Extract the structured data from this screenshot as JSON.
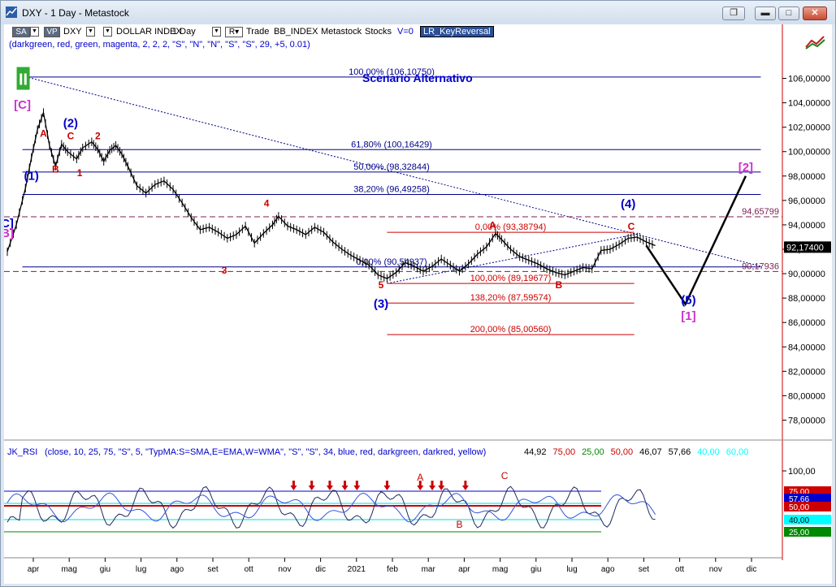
{
  "window": {
    "title": "DXY - 1 Day - Metastock",
    "buttons": [
      "restore",
      "minimize",
      "maximize",
      "close"
    ]
  },
  "toolbar": {
    "sa": "SA",
    "vp": "VP",
    "symbol": "DXY",
    "name": "DOLLAR INDEX",
    "period": "1 Day",
    "r_btn": "R",
    "trade": "Trade",
    "index": "BB_INDEX",
    "source": "Metastock",
    "stocks": "Stocks",
    "v": "V=0",
    "indicator": "LR_KeyReversal",
    "params": "(darkgreen, red, green, magenta, 2, 2, 2, \"S\", \"N\", \"N\", \"S\", \"S\", 29, +5, 0.01)"
  },
  "chart_data": {
    "type": "line",
    "title": "Scenario Alternativo",
    "price_axis": {
      "ylim": [
        76.5,
        107.5
      ],
      "ticks": [
        "106,00000",
        "104,00000",
        "102,00000",
        "100,00000",
        "98,00000",
        "96,00000",
        "94,00000",
        "92,00000",
        "90,00000",
        "88,00000",
        "86,00000",
        "84,00000",
        "82,00000",
        "80,00000",
        "78,00000"
      ],
      "tick_values": [
        106,
        104,
        102,
        100,
        98,
        96,
        94,
        92,
        90,
        88,
        86,
        84,
        82,
        80,
        78
      ]
    },
    "x_axis": {
      "labels": [
        "apr",
        "mag",
        "giu",
        "lug",
        "ago",
        "set",
        "ott",
        "nov",
        "dic",
        "2021",
        "feb",
        "mar",
        "apr",
        "mag",
        "giu",
        "lug",
        "ago",
        "set",
        "ott",
        "nov",
        "dic"
      ]
    },
    "last_price": "92,17400",
    "price_series": [
      [
        0,
        91.8
      ],
      [
        3,
        94.0
      ],
      [
        6,
        97.0
      ],
      [
        8,
        99.5
      ],
      [
        10,
        101.8
      ],
      [
        12,
        103.2
      ],
      [
        14,
        100.5
      ],
      [
        16,
        98.8
      ],
      [
        18,
        100.6
      ],
      [
        20,
        100.0
      ],
      [
        23,
        99.4
      ],
      [
        25,
        100.3
      ],
      [
        28,
        100.8
      ],
      [
        30,
        100.2
      ],
      [
        32,
        99.2
      ],
      [
        34,
        100.1
      ],
      [
        36,
        100.5
      ],
      [
        38,
        99.8
      ],
      [
        40,
        98.8
      ],
      [
        43,
        97.2
      ],
      [
        46,
        96.6
      ],
      [
        49,
        97.3
      ],
      [
        52,
        97.6
      ],
      [
        55,
        96.9
      ],
      [
        58,
        95.8
      ],
      [
        61,
        94.6
      ],
      [
        64,
        93.6
      ],
      [
        67,
        93.8
      ],
      [
        70,
        93.4
      ],
      [
        73,
        92.9
      ],
      [
        76,
        93.2
      ],
      [
        79,
        93.9
      ],
      [
        82,
        92.5
      ],
      [
        85,
        93.3
      ],
      [
        88,
        94.0
      ],
      [
        90,
        94.7
      ],
      [
        93,
        93.9
      ],
      [
        96,
        93.6
      ],
      [
        99,
        93.2
      ],
      [
        102,
        93.8
      ],
      [
        105,
        93.4
      ],
      [
        108,
        92.6
      ],
      [
        111,
        92.0
      ],
      [
        114,
        91.5
      ],
      [
        117,
        91.1
      ],
      [
        120,
        90.7
      ],
      [
        123,
        89.9
      ],
      [
        126,
        89.6
      ],
      [
        129,
        90.1
      ],
      [
        132,
        90.9
      ],
      [
        135,
        90.6
      ],
      [
        138,
        90.2
      ],
      [
        141,
        90.6
      ],
      [
        144,
        91.2
      ],
      [
        147,
        90.7
      ],
      [
        150,
        90.2
      ],
      [
        153,
        90.8
      ],
      [
        156,
        91.6
      ],
      [
        159,
        92.2
      ],
      [
        162,
        93.3
      ],
      [
        164,
        92.8
      ],
      [
        167,
        92.0
      ],
      [
        170,
        91.4
      ],
      [
        173,
        91.1
      ],
      [
        176,
        90.8
      ],
      [
        179,
        90.4
      ],
      [
        182,
        90.1
      ],
      [
        185,
        89.9
      ],
      [
        188,
        90.2
      ],
      [
        191,
        90.5
      ],
      [
        194,
        90.4
      ],
      [
        197,
        91.9
      ],
      [
        200,
        92.0
      ],
      [
        203,
        92.4
      ],
      [
        206,
        92.9
      ],
      [
        209,
        93.0
      ],
      [
        212,
        92.6
      ],
      [
        215,
        92.3
      ]
    ],
    "wave_labels": [
      {
        "text": "II",
        "color": "#ffffff",
        "bg": "#33aa33",
        "x": 5,
        "y": 106.0
      },
      {
        "text": "[C]",
        "color": "#cc33cc",
        "x": 5,
        "y": 103.5
      },
      {
        "text": "C]",
        "color": "#0000cc",
        "x": 0,
        "y": 93.8
      },
      {
        "text": "B]",
        "color": "#cc33cc",
        "x": 0,
        "y": 93.0
      },
      {
        "text": "(1)",
        "color": "#0000cc",
        "x": 8,
        "y": 97.7
      },
      {
        "text": "(2)",
        "color": "#0000cc",
        "x": 21,
        "y": 102.0
      },
      {
        "text": "A",
        "color": "#cc0000",
        "x": 12,
        "y": 101.2
      },
      {
        "text": "B",
        "color": "#cc0000",
        "x": 16,
        "y": 98.3
      },
      {
        "text": "C",
        "color": "#cc0000",
        "x": 21,
        "y": 101.0
      },
      {
        "text": "1",
        "color": "#cc0000",
        "x": 24,
        "y": 98.0
      },
      {
        "text": "2",
        "color": "#cc0000",
        "x": 30,
        "y": 101.0
      },
      {
        "text": "3",
        "color": "#cc0000",
        "x": 72,
        "y": 90.0
      },
      {
        "text": "4",
        "color": "#cc0000",
        "x": 86,
        "y": 95.5
      },
      {
        "text": "5",
        "color": "#cc0000",
        "x": 124,
        "y": 88.8
      },
      {
        "text": "(3)",
        "color": "#0000cc",
        "x": 124,
        "y": 87.2
      },
      {
        "text": "A",
        "color": "#cc0000",
        "x": 161,
        "y": 93.7
      },
      {
        "text": "B",
        "color": "#cc0000",
        "x": 183,
        "y": 88.8
      },
      {
        "text": "C",
        "color": "#cc0000",
        "x": 207,
        "y": 93.6
      },
      {
        "text": "(4)",
        "color": "#0000cc",
        "x": 206,
        "y": 95.4
      },
      {
        "text": "(5)",
        "color": "#0000cc",
        "x": 226,
        "y": 87.5
      },
      {
        "text": "[1]",
        "color": "#cc33cc",
        "x": 226,
        "y": 86.2
      },
      {
        "text": "[2]",
        "color": "#cc33cc",
        "x": 245,
        "y": 98.4
      }
    ],
    "fib_levels": [
      {
        "label": "100,00% (106,10750)",
        "value": 106.1075,
        "x0": 5,
        "x1": 250,
        "color": "#00008b"
      },
      {
        "label": "61,80% (100,16429)",
        "value": 100.16429,
        "x0": 5,
        "x1": 250,
        "color": "#00008b"
      },
      {
        "label": "50,00% (98,32844)",
        "value": 98.32844,
        "x0": 5,
        "x1": 250,
        "color": "#00008b"
      },
      {
        "label": "38,20% (96,49258)",
        "value": 96.49258,
        "x0": 5,
        "x1": 250,
        "color": "#00008b"
      },
      {
        "label": "0,00% (93,38794)",
        "value": 93.38794,
        "x0": 126,
        "x1": 208,
        "color": "#cc0000"
      },
      {
        "label": "0,00% (90,54937)",
        "value": 90.54937,
        "x0": 5,
        "x1": 250,
        "color": "#00008b"
      },
      {
        "label": "100,00% (89,19677)",
        "value": 89.19677,
        "x0": 126,
        "x1": 208,
        "color": "#cc0000"
      },
      {
        "label": "138,20% (87,59574)",
        "value": 87.59574,
        "x0": 126,
        "x1": 208,
        "color": "#cc0000"
      },
      {
        "label": "200,00% (85,00560)",
        "value": 85.0056,
        "x0": 126,
        "x1": 208,
        "color": "#cc0000"
      }
    ],
    "dashed_levels": [
      {
        "label": "94,65799",
        "value": 94.65799
      },
      {
        "label": "90,17936",
        "value": 90.17936
      }
    ],
    "projection": [
      [
        212,
        92.3
      ],
      [
        225,
        87.5
      ],
      [
        245,
        98.0
      ]
    ],
    "trendline_upper": [
      [
        5,
        106.2
      ],
      [
        250,
        90.6
      ]
    ],
    "trendline_channel": [
      [
        126,
        89.2
      ],
      [
        210,
        93.3
      ]
    ]
  },
  "rsi_panel": {
    "title": "JK_RSI",
    "params": "(close, 10, 25, 75, \"S\", 5, \"TypMA:S=SMA,E=EMA,W=WMA\", \"S\", \"S\", 34, blue, red, darkgreen, darkred, yellow)",
    "values": [
      "44,92",
      "75,00",
      "25,00",
      "50,00",
      "46,07",
      "57,66",
      "40,00",
      "60,00"
    ],
    "value_colors": [
      "#000000",
      "#cc0000",
      "#008800",
      "#cc0000",
      "#000000",
      "#000000",
      "#00ffff",
      "#00ffff"
    ],
    "ylim": [
      10,
      110
    ],
    "ticks": [
      {
        "label": "100,00",
        "value": 100
      }
    ],
    "badges": [
      {
        "label": "75,00",
        "value": 75,
        "bg": "#cc0000",
        "fg": "#ffffff"
      },
      {
        "label": "57,66",
        "value": 66,
        "bg": "#0000cc",
        "fg": "#ffffff"
      },
      {
        "label": "50,00",
        "value": 56,
        "bg": "#cc0000",
        "fg": "#ffffff"
      },
      {
        "label": "40,00",
        "value": 40,
        "bg": "#00ffff",
        "fg": "#000000"
      },
      {
        "label": "25,00",
        "value": 25,
        "bg": "#008800",
        "fg": "#ffffff"
      }
    ],
    "levels": [
      {
        "value": 75,
        "color": "#0000cc"
      },
      {
        "value": 60,
        "color": "#00dddd"
      },
      {
        "value": 57,
        "color": "#cc0000"
      },
      {
        "value": 40,
        "color": "#00dddd"
      },
      {
        "value": 25,
        "color": "#008800"
      }
    ],
    "labels": [
      {
        "text": "A",
        "x": 137,
        "y": 88
      },
      {
        "text": "B",
        "x": 150,
        "y": 30
      },
      {
        "text": "C",
        "x": 165,
        "y": 90
      }
    ],
    "arrows_x": [
      95,
      101,
      107,
      112,
      116,
      126,
      137,
      141,
      144,
      152
    ]
  }
}
